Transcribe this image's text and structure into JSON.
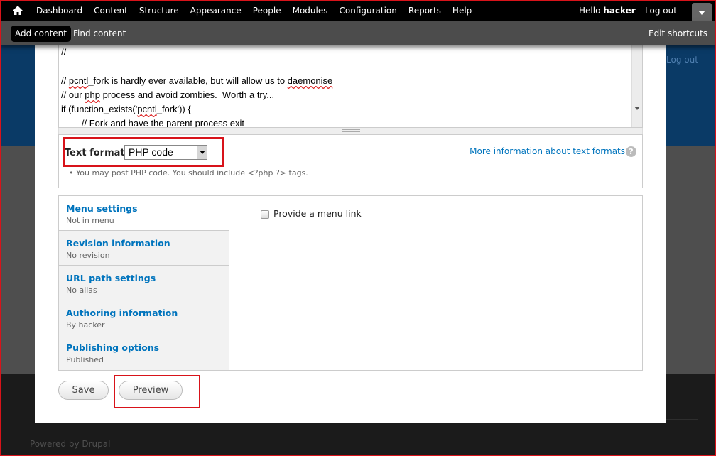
{
  "toolbar": {
    "menu": [
      "Dashboard",
      "Content",
      "Structure",
      "Appearance",
      "People",
      "Modules",
      "Configuration",
      "Reports",
      "Help"
    ],
    "hello_prefix": "Hello",
    "username": "hacker",
    "logout": "Log out"
  },
  "shortcuts": {
    "add_content": "Add content",
    "find_content": "Find content",
    "edit_shortcuts": "Edit shortcuts"
  },
  "background": {
    "logout": "Log out",
    "powered_by": "Powered by Drupal"
  },
  "editor": {
    "lines": [
      "//",
      "",
      "// pcntl_fork is hardly ever available, but will allow us to daemonise",
      "// our php process and avoid zombies.  Worth a try...",
      "if (function_exists('pcntl_fork')) {",
      "        // Fork and have the parent process exit"
    ]
  },
  "text_format": {
    "label": "Text format",
    "selected": "PHP code",
    "tip": "You may post PHP code. You should include <?php ?> tags.",
    "more_info": "More information about text formats",
    "help_icon": "?"
  },
  "vertical_tabs": [
    {
      "title": "Menu settings",
      "summary": "Not in menu"
    },
    {
      "title": "Revision information",
      "summary": "No revision"
    },
    {
      "title": "URL path settings",
      "summary": "No alias"
    },
    {
      "title": "Authoring information",
      "summary": "By hacker"
    },
    {
      "title": "Publishing options",
      "summary": "Published"
    }
  ],
  "menu_pane": {
    "checkbox_label": "Provide a menu link",
    "checked": false
  },
  "actions": {
    "save": "Save",
    "preview": "Preview"
  },
  "colors": {
    "link": "#0074bd",
    "highlight": "#d8131a",
    "toolbar": "#000000"
  }
}
